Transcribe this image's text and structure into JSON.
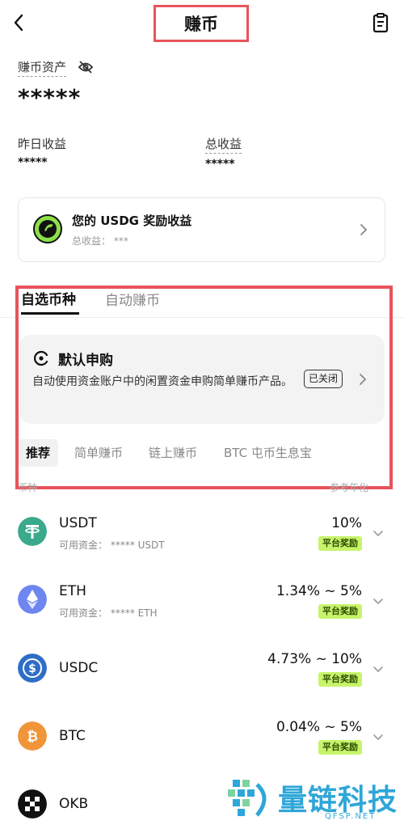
{
  "header": {
    "title": "赚币"
  },
  "assets": {
    "label": "赚币资产",
    "value": "*****"
  },
  "earnings": {
    "yesterday_label": "昨日收益",
    "yesterday_value": "*****",
    "total_label": "总收益",
    "total_value": "*****"
  },
  "reward_card": {
    "title": "您的 USDG 奖励收益",
    "subtitle": "总收益： ***"
  },
  "tabs": [
    {
      "label": "自选币种",
      "active": true
    },
    {
      "label": "自动赚币",
      "active": false
    }
  ],
  "auto_subscribe": {
    "title": "默认申购",
    "description": "自动使用资金账户中的闲置资金申购简单赚币产品。",
    "status": "已关闭"
  },
  "filters": [
    {
      "label": "推荐",
      "active": true
    },
    {
      "label": "简单赚币",
      "active": false
    },
    {
      "label": "链上赚币",
      "active": false
    },
    {
      "label": "BTC 屯币生息宝",
      "active": false
    }
  ],
  "list_header": {
    "left": "币种",
    "right": "参考年化"
  },
  "coins": [
    {
      "name": "USDT",
      "available": "可用资金： ***** USDT",
      "rate": "10%",
      "badge": "平台奖励",
      "color": "#3aa98c"
    },
    {
      "name": "ETH",
      "available": "可用资金： ***** ETH",
      "rate": "1.34% ~ 5%",
      "badge": "平台奖励",
      "color": "#6f86f0"
    },
    {
      "name": "USDC",
      "available": "",
      "rate": "4.73% ~ 10%",
      "badge": "平台奖励",
      "color": "#2f6ec6"
    },
    {
      "name": "BTC",
      "available": "",
      "rate": "0.04% ~ 5%",
      "badge": "平台奖励",
      "color": "#f0953a"
    },
    {
      "name": "OKB",
      "available": "",
      "rate": "",
      "badge": "",
      "color": "#111111"
    }
  ],
  "watermark": {
    "text": "量链科技",
    "sub": "QFSP.NET"
  }
}
